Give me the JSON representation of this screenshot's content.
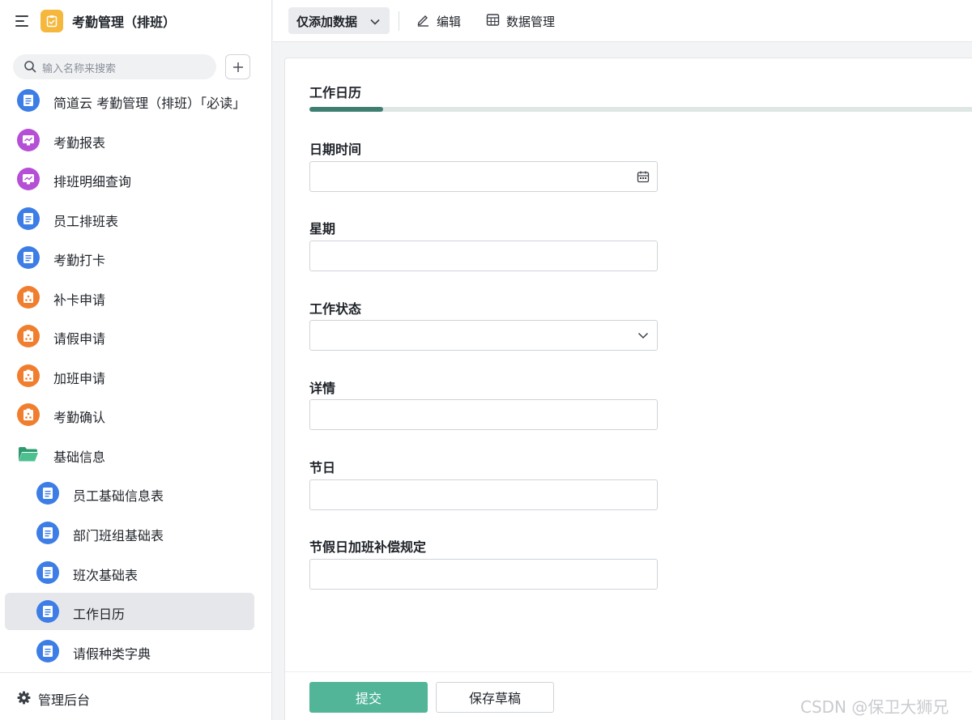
{
  "app": {
    "title": "考勤管理（排班）",
    "accent_color": "#f5b83d"
  },
  "search": {
    "placeholder": "输入名称来搜索"
  },
  "sidebar": {
    "items": [
      {
        "label": "简道云 考勤管理（排班）「必读」",
        "icon": "form-icon",
        "color": "#3d7de6"
      },
      {
        "label": "考勤报表",
        "icon": "report-icon",
        "color": "#b44fd6"
      },
      {
        "label": "排班明细查询",
        "icon": "report-icon",
        "color": "#b44fd6"
      },
      {
        "label": "员工排班表",
        "icon": "form-icon",
        "color": "#3d7de6"
      },
      {
        "label": "考勤打卡",
        "icon": "form-icon",
        "color": "#3d7de6"
      },
      {
        "label": "补卡申请",
        "icon": "workflow-icon",
        "color": "#f07e2e"
      },
      {
        "label": "请假申请",
        "icon": "workflow-icon",
        "color": "#f07e2e"
      },
      {
        "label": "加班申请",
        "icon": "workflow-icon",
        "color": "#f07e2e"
      },
      {
        "label": "考勤确认",
        "icon": "workflow-icon",
        "color": "#f07e2e"
      },
      {
        "label": "基础信息",
        "icon": "folder-icon",
        "color": "#3aa57c"
      },
      {
        "label": "员工基础信息表",
        "icon": "form-icon",
        "color": "#3d7de6"
      },
      {
        "label": "部门班组基础表",
        "icon": "form-icon",
        "color": "#3d7de6"
      },
      {
        "label": "班次基础表",
        "icon": "form-icon",
        "color": "#3d7de6"
      },
      {
        "label": "工作日历",
        "icon": "form-icon",
        "color": "#3d7de6",
        "active": true
      },
      {
        "label": "请假种类字典",
        "icon": "form-icon",
        "color": "#3d7de6"
      }
    ],
    "footer_label": "管理后台"
  },
  "toolbar": {
    "mode_label": "仅添加数据",
    "edit_label": "编辑",
    "data_label": "数据管理"
  },
  "form": {
    "title": "工作日历",
    "progress_percent": 11,
    "fields": [
      {
        "label": "日期时间",
        "type": "date",
        "value": ""
      },
      {
        "label": "星期",
        "type": "text",
        "value": ""
      },
      {
        "label": "工作状态",
        "type": "select",
        "value": ""
      },
      {
        "label": "详情",
        "type": "text",
        "value": ""
      },
      {
        "label": "节日",
        "type": "text",
        "value": ""
      },
      {
        "label": "节假日加班补偿规定",
        "type": "text",
        "value": ""
      }
    ],
    "submit_label": "提交",
    "draft_label": "保存草稿"
  },
  "watermark": "CSDN @保卫大狮兄"
}
